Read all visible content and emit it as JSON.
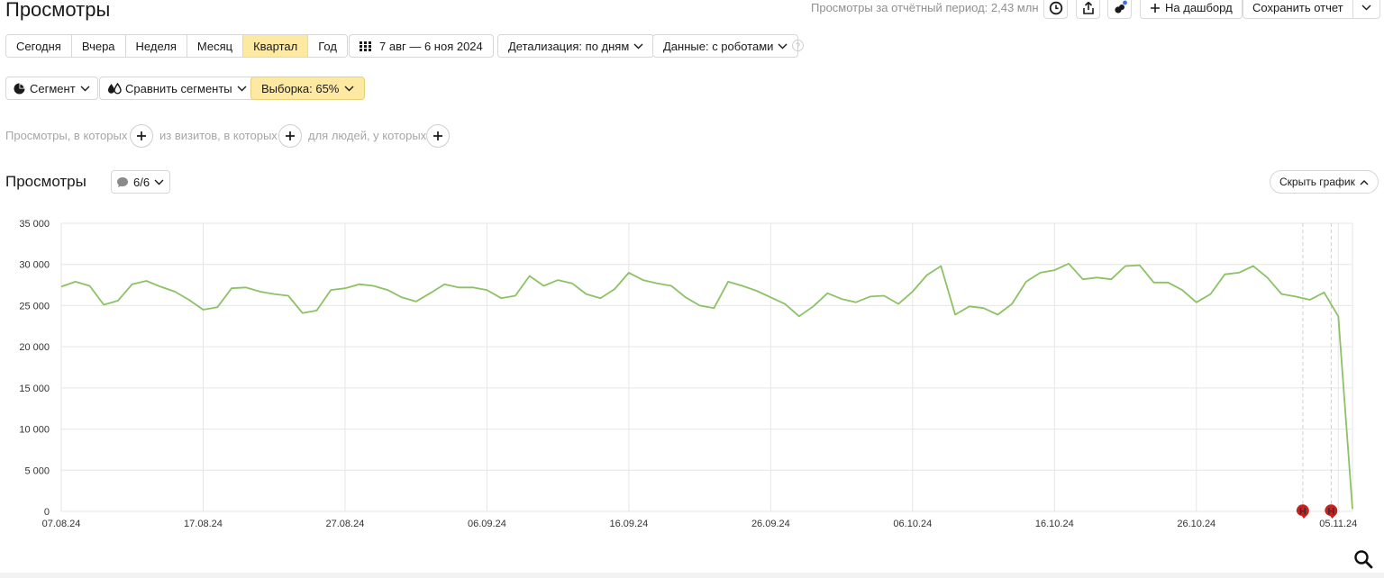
{
  "header": {
    "title": "Просмотры",
    "period_stat": "Просмотры за отчётный период: 2,43 млн",
    "to_dashboard_label": "На дашборд",
    "save_report_label": "Сохранить отчет"
  },
  "period_tabs": [
    {
      "label": "Сегодня",
      "active": false
    },
    {
      "label": "Вчера",
      "active": false
    },
    {
      "label": "Неделя",
      "active": false
    },
    {
      "label": "Месяц",
      "active": false
    },
    {
      "label": "Квартал",
      "active": true
    },
    {
      "label": "Год",
      "active": false
    }
  ],
  "date_range": "7 авг — 6 ноя 2024",
  "detail_dropdown": "Детализация: по дням",
  "data_dropdown": "Данные: с роботами",
  "help_mark": "?",
  "segment_button": "Сегмент",
  "compare_button": "Сравнить сегменты",
  "sample_button": "Выборка: 65%",
  "filters": {
    "views_text": "Просмотры, в которых",
    "visits_text": "из визитов, в которых",
    "people_text": "для людей, у которых"
  },
  "chart_section": {
    "title": "Просмотры",
    "series_selector": "6/6",
    "hide_chart_label": "Скрыть график"
  },
  "colors": {
    "accent_yellow": "#fde9a2",
    "line_green": "#8cc265",
    "weekend_red": "#c0392b",
    "grid": "#e6e6e6",
    "annotation_red": "#cc1f1f"
  },
  "chart_data": {
    "type": "line",
    "ylim": [
      0,
      35000
    ],
    "yticks": [
      "0",
      "5 000",
      "10 000",
      "15 000",
      "20 000",
      "25 000",
      "30 000",
      "35 000"
    ],
    "ytick_values": [
      0,
      5000,
      10000,
      15000,
      20000,
      25000,
      30000,
      35000
    ],
    "xlabels": [
      {
        "label": "07.08.24",
        "index": 0,
        "holiday": false
      },
      {
        "label": "17.08.24",
        "index": 10,
        "holiday": true
      },
      {
        "label": "27.08.24",
        "index": 20,
        "holiday": false
      },
      {
        "label": "06.09.24",
        "index": 30,
        "holiday": false
      },
      {
        "label": "16.09.24",
        "index": 40,
        "holiday": false
      },
      {
        "label": "26.09.24",
        "index": 50,
        "holiday": false
      },
      {
        "label": "06.10.24",
        "index": 60,
        "holiday": true
      },
      {
        "label": "16.10.24",
        "index": 70,
        "holiday": false
      },
      {
        "label": "26.10.24",
        "index": 80,
        "holiday": true
      },
      {
        "label": "05.11.24",
        "index": 90,
        "holiday": false
      }
    ],
    "annotations": [
      {
        "label": "Н",
        "index": 87.5
      },
      {
        "label": "Н",
        "index": 89.5
      }
    ],
    "dashed_lines": [
      87.5,
      89.5
    ],
    "values": [
      27300,
      27900,
      27400,
      25100,
      25600,
      27600,
      28000,
      27300,
      26700,
      25700,
      24500,
      24800,
      27100,
      27200,
      26700,
      26400,
      26200,
      24100,
      24400,
      26900,
      27100,
      27600,
      27400,
      26900,
      26000,
      25500,
      26500,
      27600,
      27200,
      27200,
      26900,
      25900,
      26200,
      28600,
      27400,
      28100,
      27700,
      26400,
      25900,
      27000,
      29000,
      28100,
      27700,
      27400,
      26000,
      25000,
      24700,
      27900,
      27400,
      26800,
      26000,
      25200,
      23700,
      24900,
      26500,
      25800,
      25400,
      26100,
      26200,
      25200,
      26700,
      28700,
      29800,
      23900,
      24900,
      24700,
      23900,
      25200,
      27900,
      29000,
      29300,
      30100,
      28200,
      28400,
      28200,
      29800,
      29900,
      27800,
      27800,
      26900,
      25400,
      26400,
      28800,
      29000,
      29800,
      28400,
      26400,
      26100,
      25700,
      26600,
      23700,
      300
    ]
  }
}
